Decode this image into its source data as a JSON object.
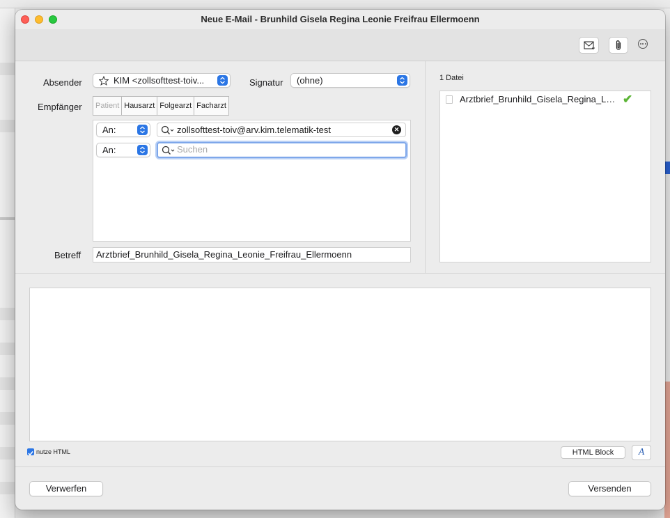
{
  "window": {
    "title": "Neue E-Mail - Brunhild Gisela Regina Leonie Freifrau Ellermoenn"
  },
  "toolbar": {
    "icons": [
      "new-mail-icon",
      "paperclip-icon",
      "more-icon"
    ]
  },
  "sender": {
    "label": "Absender",
    "value": "KIM <zollsofttest-toiv..."
  },
  "signature": {
    "label": "Signatur",
    "value": "(ohne)"
  },
  "recipients": {
    "label": "Empfänger",
    "quick_buttons": [
      "Patient",
      "Hausarzt",
      "Folgearzt",
      "Facharzt"
    ],
    "rows": [
      {
        "type": "An:",
        "address": "zollsofttest-toiv@arv.kim.telematik-test"
      },
      {
        "type": "An:",
        "address": ""
      }
    ],
    "search_placeholder": "Suchen"
  },
  "subject": {
    "label": "Betreff",
    "value": "Arztbrief_Brunhild_Gisela_Regina_Leonie_Freifrau_Ellermoenn"
  },
  "attachments": {
    "count_label": "1 Datei",
    "files": [
      {
        "name": "Arztbrief_Brunhild_Gisela_Regina_Leonie_Freifrau_Ellermoenn"
      }
    ]
  },
  "editor": {
    "use_html_label": "nutze HTML",
    "use_html_checked": true,
    "html_block_label": "HTML Block",
    "font_button_label": "A"
  },
  "footer": {
    "discard_label": "Verwerfen",
    "send_label": "Versenden"
  },
  "colors": {
    "accent": "#2b76e5",
    "check": "#5cb536"
  }
}
